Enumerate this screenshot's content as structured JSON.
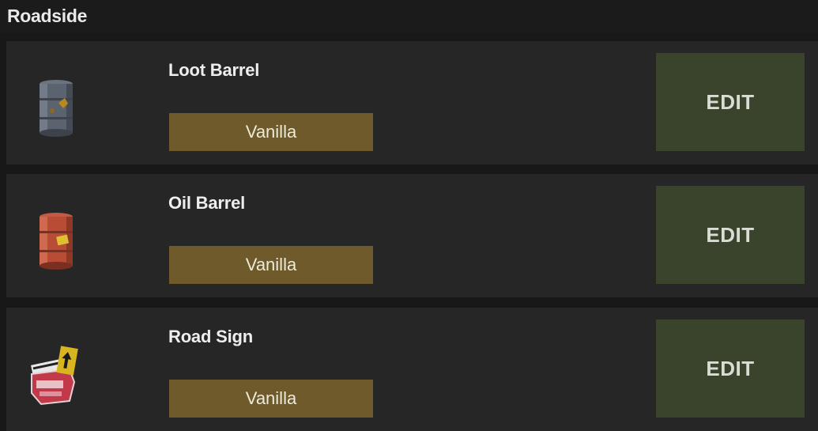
{
  "section": {
    "title": "Roadside"
  },
  "colors": {
    "badge_bg": "#6e5a2b",
    "edit_bg": "#3a442d",
    "row_bg": "#262626",
    "page_bg": "#181818"
  },
  "items": [
    {
      "name": "Loot Barrel",
      "tag": "Vanilla",
      "edit_label": "EDIT",
      "icon": "loot-barrel-icon"
    },
    {
      "name": "Oil Barrel",
      "tag": "Vanilla",
      "edit_label": "EDIT",
      "icon": "oil-barrel-icon"
    },
    {
      "name": "Road Sign",
      "tag": "Vanilla",
      "edit_label": "EDIT",
      "icon": "road-sign-icon"
    }
  ]
}
